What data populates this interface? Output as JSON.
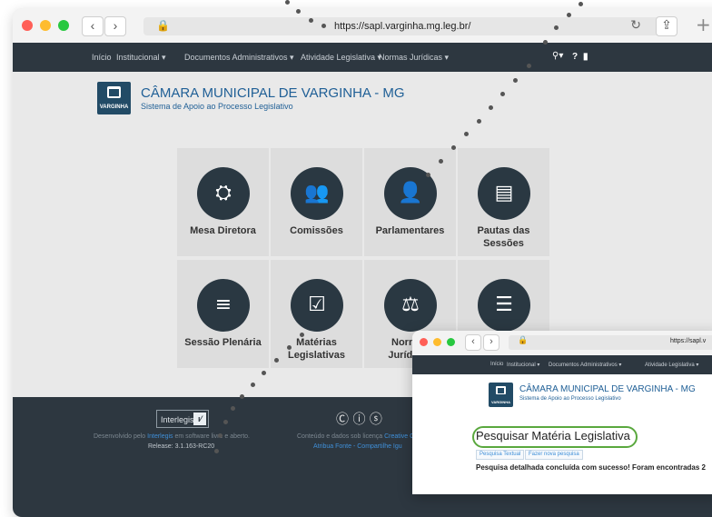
{
  "browser": {
    "url": "https://sapl.varginha.mg.leg.br/",
    "back_icon": "chevron-left-icon",
    "forward_icon": "chevron-right-icon"
  },
  "nav": {
    "items": [
      "Início",
      "Institucional ▾",
      "Documentos Administrativos ▾",
      "Atividade Legislativa ▾",
      "Normas Jurídicas ▾"
    ]
  },
  "header": {
    "logo_text": "VARGINHA",
    "title": "CÂMARA MUNICIPAL DE VARGINHA - MG",
    "subtitle": "Sistema de Apoio ao Processo Legislativo"
  },
  "tiles": [
    {
      "label": "Mesa Diretora",
      "icon": "meeting-table-icon"
    },
    {
      "label": "Comissões",
      "icon": "group-icon"
    },
    {
      "label": "Parlamentares",
      "icon": "person-icon"
    },
    {
      "label": "Pautas das Sessões",
      "icon": "clipboard-list-icon"
    },
    {
      "label": "Sessão Plenária",
      "icon": "plenary-icon"
    },
    {
      "label": "Matérias Legislativas",
      "icon": "checked-document-icon"
    },
    {
      "label": "Normas Jurídicas",
      "icon": "scales-icon"
    },
    {
      "label": "",
      "icon": "document-list-icon"
    }
  ],
  "footer": {
    "interlegis_label": "Interlegis",
    "dev_prefix": "Desenvolvido pelo ",
    "dev_link": "Interlegis",
    "dev_suffix": " em software livre e aberto.",
    "release": "Release: 3.1.163-RC20",
    "license_prefix": "Conteúdo e dados sob licença ",
    "license_link": "Creative Cor",
    "links": "Atribua Fonte - Compartilhe Igu"
  },
  "window2": {
    "url": "https://sapl.v",
    "nav_items": [
      "Início",
      "Institucional ▾",
      "Documentos Administrativos ▾",
      "Atividade Legislativa ▾"
    ],
    "title": "CÂMARA MUNICIPAL DE VARGINHA - MG",
    "subtitle": "Sistema de Apoio ao Processo Legislativo",
    "logo_text": "VARGINHA",
    "page_title": "Pesquisar Matéria Legislativa",
    "btn_textual": "Pesquisa Textual",
    "btn_nova": "Fazer nova pesquisa",
    "result": "Pesquisa detalhada concluída com sucesso! Foram encontradas 2"
  },
  "colors": {
    "nav_bg": "#2d3740",
    "brand_blue": "#1f5f96",
    "logo_bg": "#224b66",
    "tile_bg": "#dddddd",
    "highlight_green": "#5aa83e"
  }
}
